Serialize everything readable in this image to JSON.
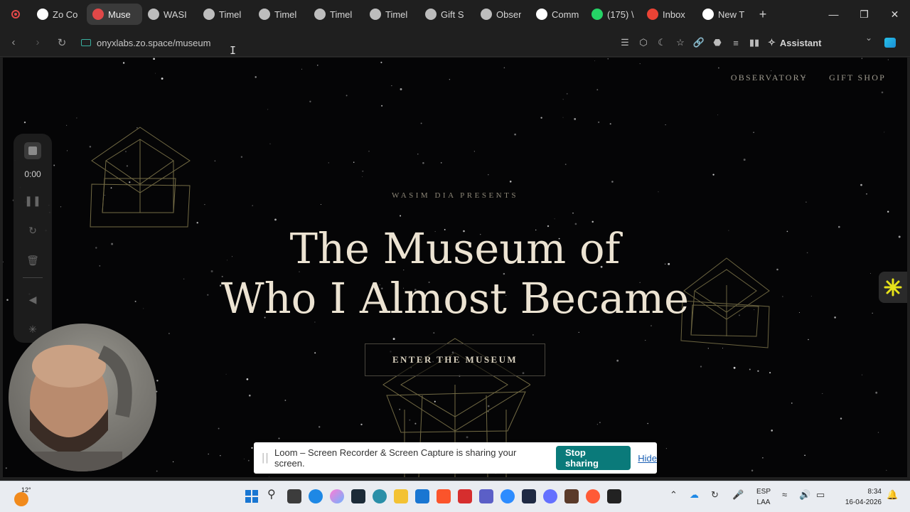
{
  "browser": {
    "tabs": [
      {
        "label": "Zo Co",
        "icon": "zo-icon",
        "color": "#ffffff"
      },
      {
        "label": "Muse",
        "icon": "recording-icon",
        "color": "#e04848",
        "active": true
      },
      {
        "label": "WASI",
        "icon": "globe-icon",
        "color": "#bdbdbd"
      },
      {
        "label": "Timel",
        "icon": "globe-icon",
        "color": "#bdbdbd"
      },
      {
        "label": "Timel",
        "icon": "globe-icon",
        "color": "#bdbdbd"
      },
      {
        "label": "Timel",
        "icon": "globe-icon",
        "color": "#bdbdbd"
      },
      {
        "label": "Timel",
        "icon": "globe-icon",
        "color": "#bdbdbd"
      },
      {
        "label": "Gift S",
        "icon": "globe-icon",
        "color": "#bdbdbd"
      },
      {
        "label": "Obser",
        "icon": "globe-icon",
        "color": "#bdbdbd"
      },
      {
        "label": "Comm",
        "icon": "sparkle-icon",
        "color": "#ffffff"
      },
      {
        "label": "(175) \\",
        "icon": "whatsapp-icon",
        "color": "#25d366"
      },
      {
        "label": "Inbox",
        "icon": "gmail-icon",
        "color": "#ea4335"
      },
      {
        "label": "New T",
        "icon": "browser-icon",
        "color": "#ffffff"
      }
    ],
    "url": "onyxlabs.zo.space/museum",
    "assistant_label": "Assistant"
  },
  "page": {
    "nav": [
      "OBSERVATORY",
      "GIFT SHOP"
    ],
    "presents": "WASIM DIA PRESENTS",
    "title_line1": "The Museum of",
    "title_line2": "Who I Almost Became",
    "enter_button": "ENTER THE MUSEUM"
  },
  "loom": {
    "timer": "0:00",
    "share_message": "Loom – Screen Recorder & Screen Capture is sharing your screen.",
    "stop_label": "Stop sharing",
    "hide_label": "Hide"
  },
  "taskbar": {
    "temperature": "12°",
    "lang_line1": "ESP",
    "lang_line2": "LAA",
    "time": "8:34",
    "date": "16-04-2026"
  },
  "colors": {
    "page_bg": "#050506",
    "title": "#ece3d2",
    "accent_gold": "#b5a46a",
    "loom_teal": "#0a7a7a"
  }
}
